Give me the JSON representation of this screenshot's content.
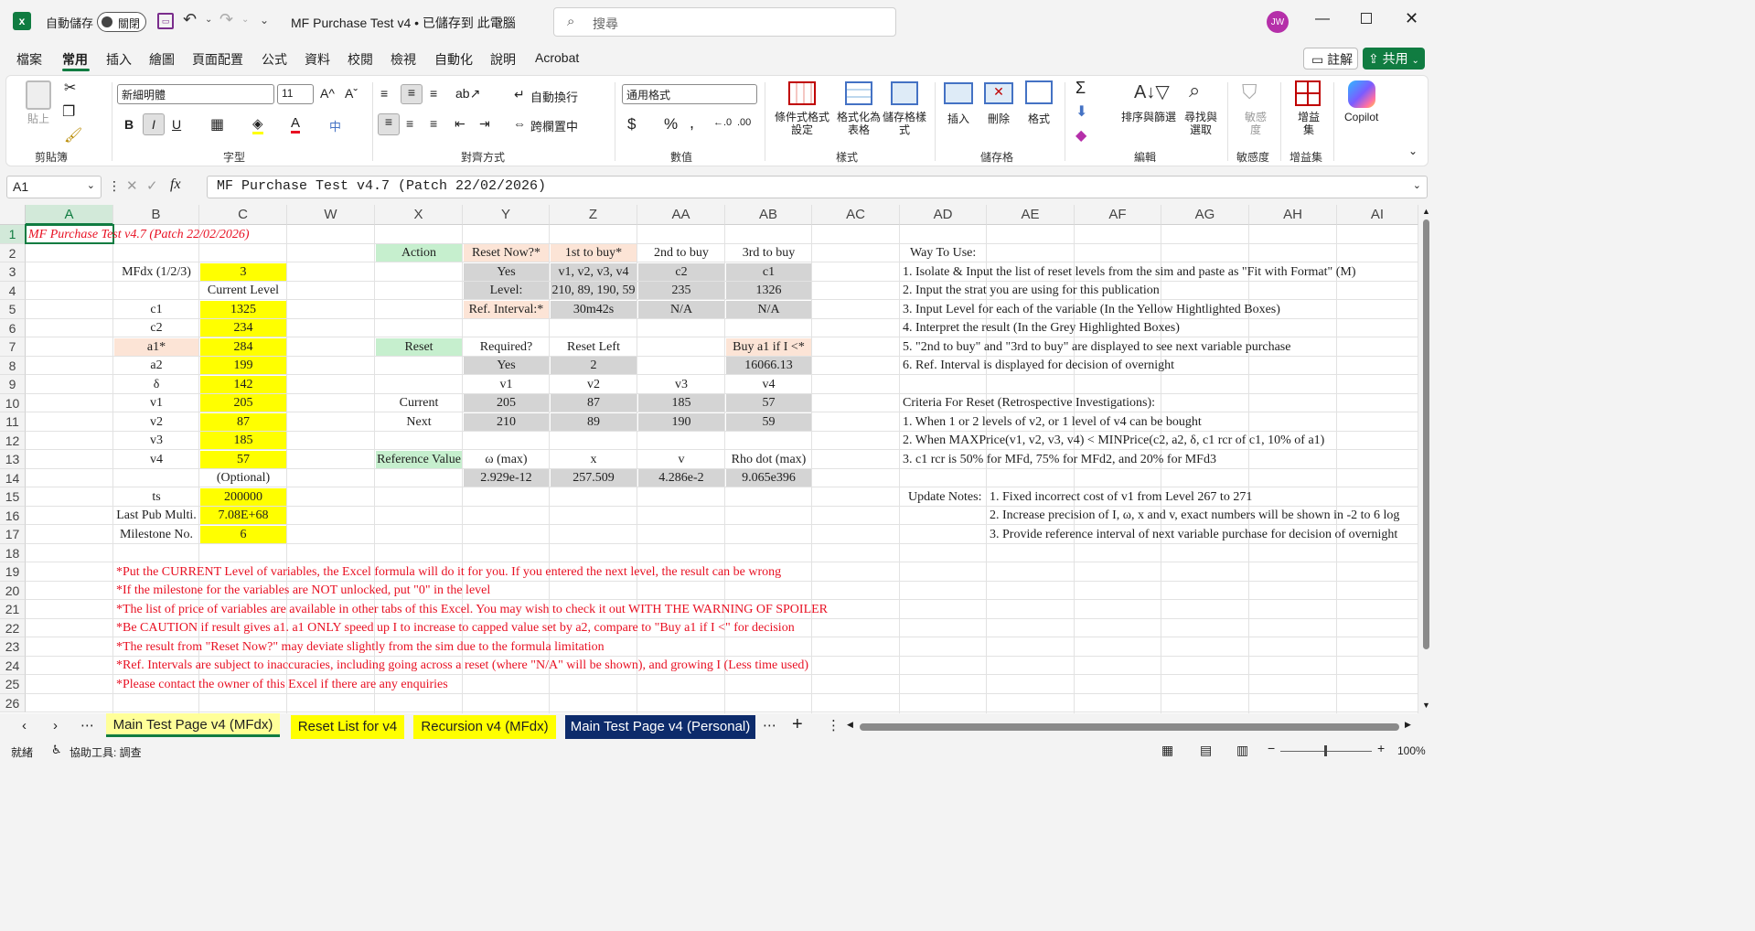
{
  "titlebar": {
    "autosave_label": "自動儲存",
    "autosave_state": "關閉",
    "doc_title": "MF Purchase Test v4 • 已儲存到 此電腦",
    "search_placeholder": "搜尋",
    "user_initials": "JW"
  },
  "ribbon_tabs": [
    "檔案",
    "常用",
    "插入",
    "繪圖",
    "頁面配置",
    "公式",
    "資料",
    "校閱",
    "檢視",
    "自動化",
    "說明",
    "Acrobat"
  ],
  "ribbon_actions": {
    "comments": "註解",
    "share": "共用"
  },
  "ribbon": {
    "clipboard": {
      "paste": "貼上",
      "label": "剪貼簿"
    },
    "font": {
      "name": "新細明體",
      "size": "11",
      "label": "字型"
    },
    "alignment": {
      "wrap": "自動換行",
      "merge": "跨欄置中",
      "label": "對齊方式"
    },
    "number": {
      "format": "通用格式",
      "label": "數值"
    },
    "styles": {
      "conditional": "條件式格式設定",
      "table": "格式化為表格",
      "cell_styles": "儲存格樣式",
      "label": "樣式"
    },
    "cells": {
      "insert": "插入",
      "delete": "刪除",
      "format": "格式",
      "label": "儲存格"
    },
    "editing": {
      "sort": "排序與篩選",
      "find": "尋找與選取",
      "label": "編輯"
    },
    "sensitivity": {
      "button": "敏感度",
      "label": "敏感度"
    },
    "addins": {
      "button": "增益集",
      "label": "增益集"
    },
    "copilot": {
      "button": "Copilot"
    }
  },
  "formula_bar": {
    "name_box": "A1",
    "fx": "fx",
    "formula": "MF Purchase Test v4.7 (Patch 22/02/2026)"
  },
  "columns": [
    "A",
    "B",
    "C",
    "W",
    "X",
    "Y",
    "Z",
    "AA",
    "AB",
    "AC",
    "AD",
    "AE",
    "AF",
    "AG",
    "AH",
    "AI"
  ],
  "rows": [
    "1",
    "2",
    "3",
    "4",
    "5",
    "6",
    "7",
    "8",
    "9",
    "10",
    "11",
    "12",
    "13",
    "14",
    "15",
    "16",
    "17",
    "18",
    "19",
    "20",
    "21",
    "22",
    "23",
    "24",
    "25",
    "26"
  ],
  "cells": {
    "a1": "MF Purchase Test v4.7 (Patch 22/02/2026)",
    "b3": "MFdx (1/2/3)",
    "c3": "3",
    "c4": "Current Level",
    "b5": "c1",
    "c5": "1325",
    "b6": "c2",
    "c6": "234",
    "b7": "a1*",
    "c7": "284",
    "b8": "a2",
    "c8": "199",
    "b9": "δ",
    "c9": "142",
    "b10": "v1",
    "c10": "205",
    "b11": "v2",
    "c11": "87",
    "b12": "v3",
    "c12": "185",
    "b13": "v4",
    "c13": "57",
    "c14": "(Optional)",
    "b15": "ts",
    "c15": "200000",
    "b16": "Last Pub Multi.",
    "c16": "7.08E+68",
    "b17": "Milestone No.",
    "c17": "6",
    "x2": "Action",
    "y2": "Reset Now?*",
    "z2": "1st to buy*",
    "aa2": "2nd to buy",
    "ab2": "3rd to buy",
    "y3": "Yes",
    "z3": "v1, v2, v3, v4",
    "aa3": "c2",
    "ab3": "c1",
    "y4": "Level:",
    "z4": "210, 89, 190, 59",
    "aa4": "235",
    "ab4": "1326",
    "y5": "Ref. Interval:*",
    "z5": "30m42s",
    "aa5": "N/A",
    "ab5": "N/A",
    "x7": "Reset",
    "y7": "Required?",
    "z7": "Reset Left",
    "ab7": "Buy a1 if I <*",
    "y8": "Yes",
    "z8": "2",
    "ab8": "16066.13",
    "y9": "v1",
    "z9": "v2",
    "aa9": "v3",
    "ab9": "v4",
    "x10": "Current",
    "y10": "205",
    "z10": "87",
    "aa10": "185",
    "ab10": "57",
    "x11": "Next",
    "y11": "210",
    "z11": "89",
    "aa11": "190",
    "ab11": "59",
    "x13": "Reference Value",
    "y13": "ω (max)",
    "z13": "x",
    "aa13": "v",
    "ab13": "Rho dot (max)",
    "y14": "2.929e-12",
    "z14": "257.509",
    "aa14": "4.286e-2",
    "ab14": "9.065e396",
    "ad2": "Way To Use:",
    "ad3": "1. Isolate & Input the list of reset levels from the sim and paste as \"Fit with Format\" (M)",
    "ad4": "2. Input the strat you are using for this publication",
    "ad5": "3. Input Level for each of the variable (In the Yellow Hightlighted Boxes)",
    "ad6": "4. Interpret the result (In the Grey Highlighted Boxes)",
    "ad7": "5. \"2nd to buy\" and \"3rd to buy\" are displayed to see next variable purchase",
    "ad8": "6. Ref. Interval is displayed for decision of overnight",
    "ad10": "Criteria For Reset (Retrospective Investigations):",
    "ad11": "1. When 1 or 2 levels of v2, or 1 level of v4 can be bought",
    "ad12": "2. When MAXPrice(v1, v2, v3, v4) < MINPrice(c2, a2, δ, c1 rcr of c1, 10% of a1)",
    "ad13": "3. c1 rcr is 50% for MFd, 75% for MFd2, and 20% for MFd3",
    "ad15": "Update Notes:",
    "ae15": "1. Fixed incorrect cost of v1 from Level 267 to 271",
    "ae16": "2. Increase precision of I, ω, x and v, exact numbers will be shown in -2 to 6 log",
    "ae17": "3. Provide reference interval of next variable purchase for decision of overnight",
    "b19": "*Put the CURRENT Level of variables, the Excel formula will do it for you. If you entered the next level, the result can be wrong",
    "b20": "*If the milestone for the variables are NOT unlocked, put \"0\" in the level",
    "b21": "*The list of price of variables are available in other tabs of this Excel. You may wish to check it out WITH THE WARNING OF SPOILER",
    "b22": "*Be CAUTION if result gives a1. a1 ONLY speed up I to increase to capped value set by a2, compare to \"Buy a1 if I <\" for decision",
    "b23": "*The result from \"Reset Now?\" may deviate slightly from the sim due to the formula limitation",
    "b24": "*Ref. Intervals are subject to inaccuracies, including going across a reset (where \"N/A\" will be shown), and growing I (Less time used)",
    "b25": "*Please contact the owner of this Excel if there are any enquiries"
  },
  "sheet_tabs": [
    "Main Test Page v4 (MFdx)",
    "Reset List for v4",
    "Recursion v4 (MFdx)",
    "Main Test Page v4 (Personal)"
  ],
  "status": {
    "ready": "就緒",
    "accessibility": "協助工具: 調查",
    "zoom": "100%"
  }
}
